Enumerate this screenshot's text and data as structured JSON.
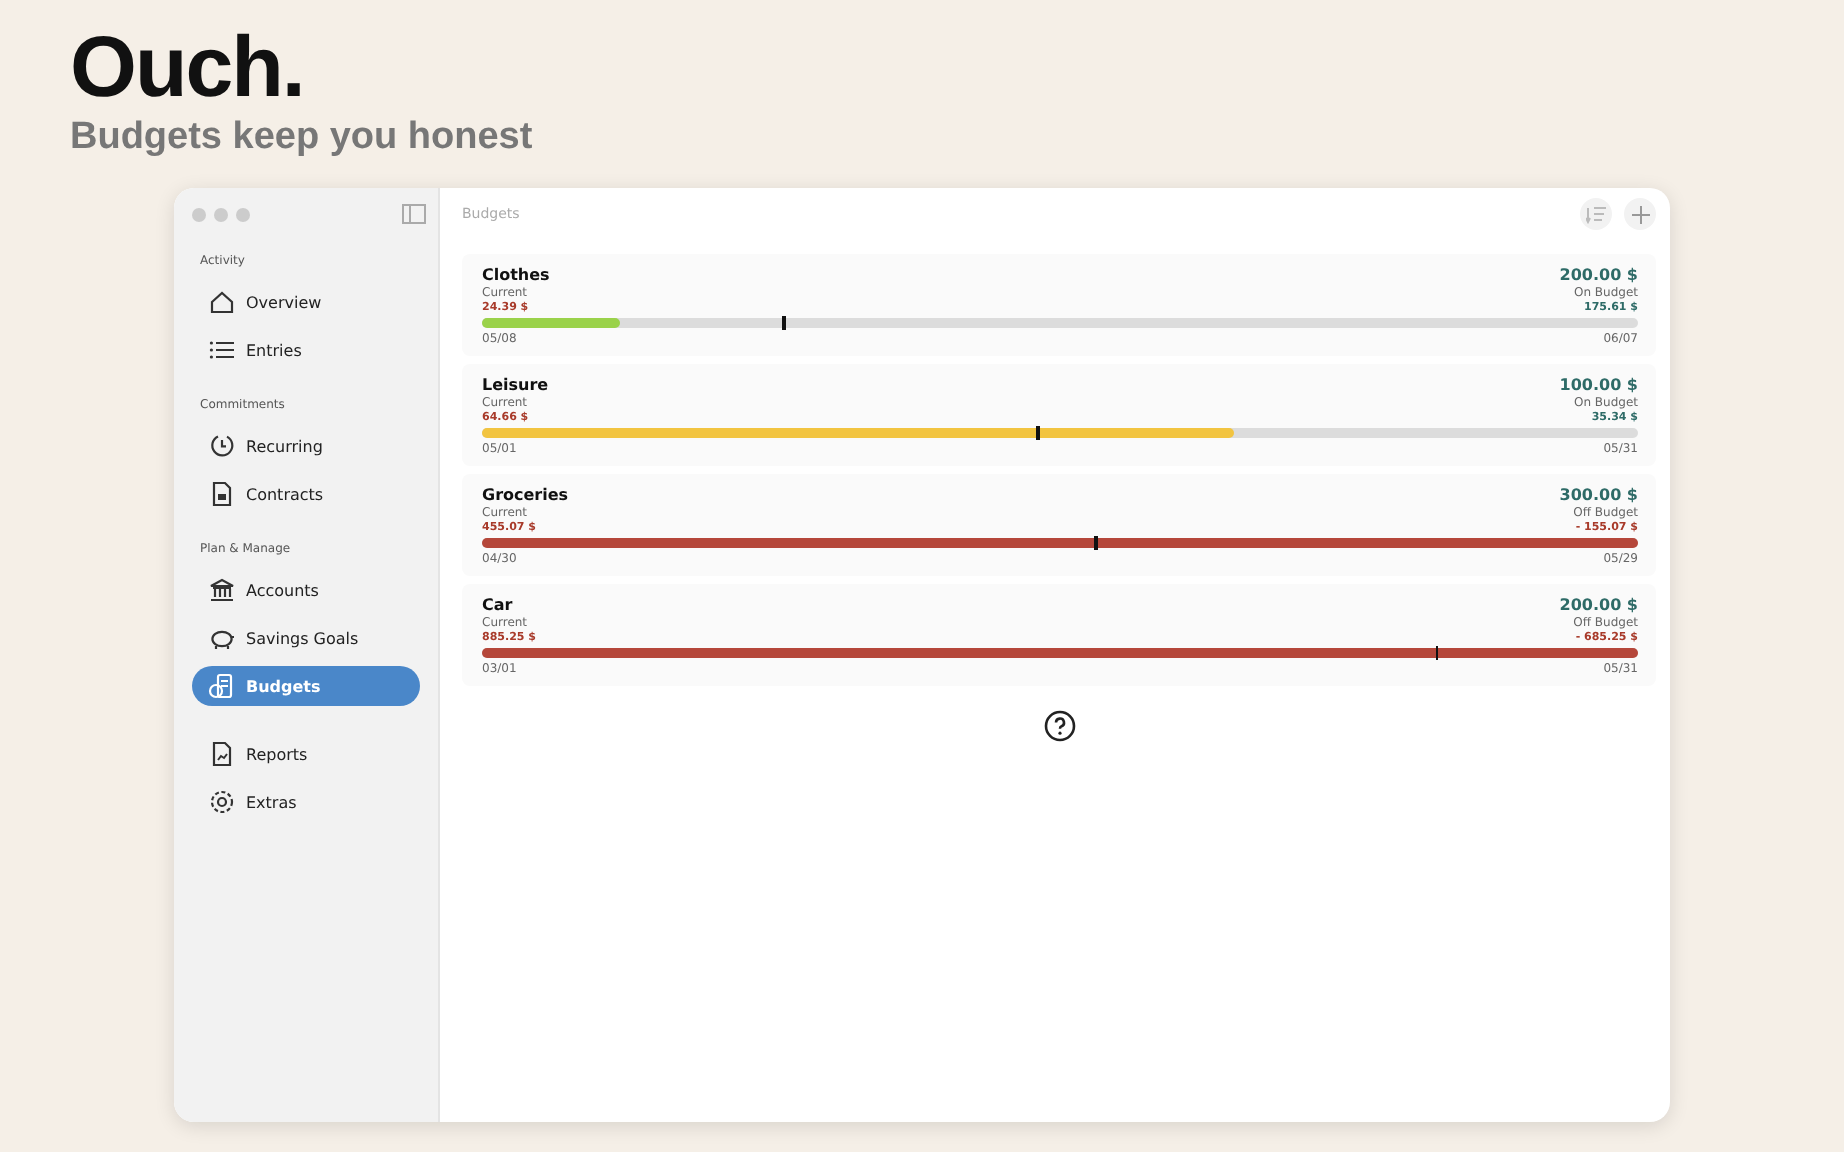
{
  "headline": "Ouch.",
  "subtitle": "Budgets keep you honest",
  "window": {
    "title": "Budgets"
  },
  "sidebar": {
    "sections": [
      {
        "heading": "Activity",
        "items": [
          {
            "label": "Overview",
            "kind": "house",
            "selected": false
          },
          {
            "label": "Entries",
            "kind": "list",
            "selected": false
          }
        ]
      },
      {
        "heading": "Commitments",
        "items": [
          {
            "label": "Recurring",
            "kind": "timer",
            "selected": false
          },
          {
            "label": "Contracts",
            "kind": "doc",
            "selected": false
          }
        ]
      },
      {
        "heading": "Plan & Manage",
        "items": [
          {
            "label": "Accounts",
            "kind": "bank",
            "selected": false
          },
          {
            "label": "Savings Goals",
            "kind": "piggy",
            "selected": false
          },
          {
            "label": "Budgets",
            "kind": "coins",
            "selected": true
          }
        ]
      },
      {
        "items": [
          {
            "label": "Reports",
            "kind": "report",
            "selected": false
          },
          {
            "label": "Extras",
            "kind": "gear",
            "selected": false
          }
        ]
      }
    ]
  },
  "budgets": [
    {
      "name": "Clothes",
      "current_label": "Current",
      "current": "24.39 $",
      "amount": "200.00 $",
      "kind": "on",
      "status_label": "On Budget",
      "remaining": "175.61 $",
      "start": "05/08",
      "end": "06/07",
      "color": "#9ad24a",
      "level": 0.12,
      "today": {
        "level": 0.26
      }
    },
    {
      "name": "Leisure",
      "current_label": "Current",
      "current": "64.66 $",
      "amount": "100.00 $",
      "kind": "on",
      "status_label": "On Budget",
      "remaining": "35.34 $",
      "start": "05/01",
      "end": "05/31",
      "color": "#f2c440",
      "level": 0.65,
      "today": {
        "level": 0.48
      }
    },
    {
      "name": "Groceries",
      "current_label": "Current",
      "current": "455.07 $",
      "amount": "300.00 $",
      "kind": "off",
      "status_label": "Off Budget",
      "remaining": "- 155.07 $",
      "start": "04/30",
      "end": "05/29",
      "color": "#b5473a",
      "level": 1,
      "today": {
        "level": 0.53
      }
    },
    {
      "name": "Car",
      "current_label": "Current",
      "current": "885.25 $",
      "amount": "200.00 $",
      "kind": "off",
      "status_label": "Off Budget",
      "remaining": "- 685.25 $",
      "start": "03/01",
      "end": "05/31",
      "color": "#b5473a",
      "level": 1,
      "today": {
        "level": 0.825
      }
    }
  ]
}
